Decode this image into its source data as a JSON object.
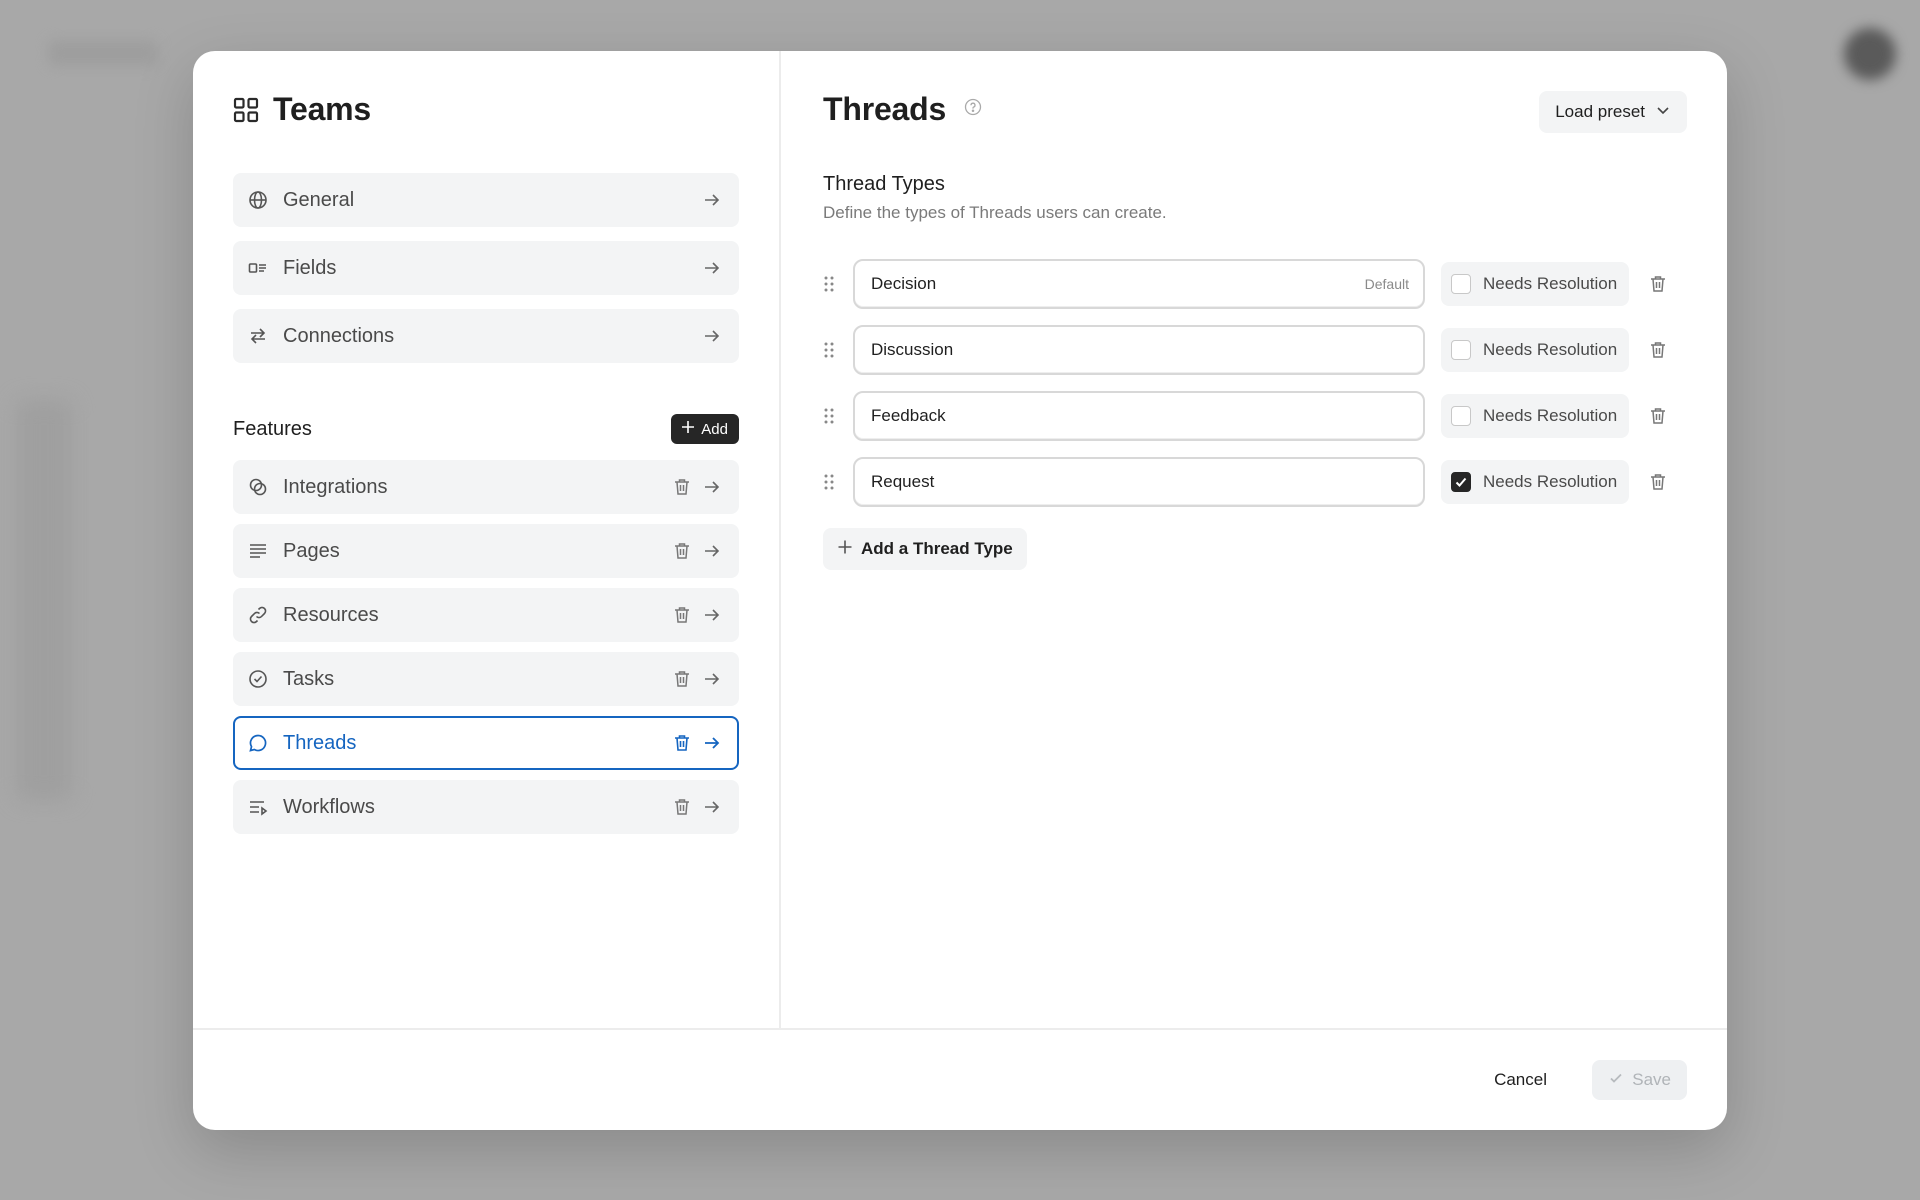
{
  "left": {
    "title": "Teams",
    "top_items": [
      {
        "label": "General",
        "icon": "globe-icon"
      },
      {
        "label": "Fields",
        "icon": "fields-icon"
      },
      {
        "label": "Connections",
        "icon": "swap-arrows-icon"
      }
    ],
    "features_title": "Features",
    "add_label": "Add",
    "features": [
      {
        "label": "Integrations",
        "icon": "integrations-icon"
      },
      {
        "label": "Pages",
        "icon": "text-lines-icon"
      },
      {
        "label": "Resources",
        "icon": "link-icon"
      },
      {
        "label": "Tasks",
        "icon": "check-circle-icon"
      },
      {
        "label": "Threads",
        "icon": "chat-bubble-icon",
        "selected": true
      },
      {
        "label": "Workflows",
        "icon": "workflow-icon"
      }
    ]
  },
  "right": {
    "title": "Threads",
    "preset_label": "Load preset",
    "section_title": "Thread Types",
    "section_desc": "Define the types of Threads users can create.",
    "thread_types": [
      {
        "name": "Decision",
        "badge": "Default",
        "needs_resolution": false
      },
      {
        "name": "Discussion",
        "badge": "",
        "needs_resolution": false
      },
      {
        "name": "Feedback",
        "badge": "",
        "needs_resolution": false
      },
      {
        "name": "Request",
        "badge": "",
        "needs_resolution": true
      }
    ],
    "needs_resolution_label": "Needs Resolution",
    "add_type_label": "Add a Thread Type"
  },
  "footer": {
    "cancel_label": "Cancel",
    "save_label": "Save"
  },
  "colors": {
    "accent": "#1565c0",
    "dark_button": "#262626",
    "item_bg": "#f3f4f5"
  }
}
